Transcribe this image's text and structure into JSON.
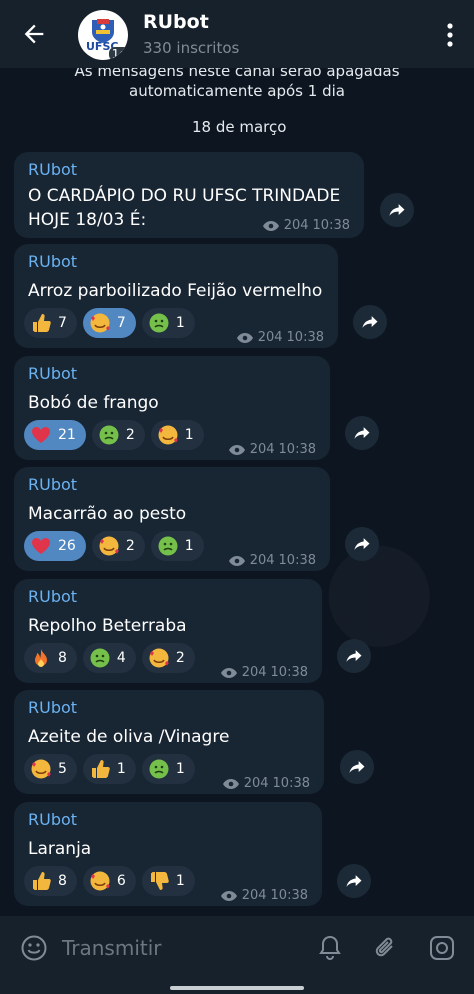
{
  "header": {
    "title": "RUbot",
    "subtitle": "330 inscritos",
    "avatar_text": "UFSC",
    "avatar_timer": "1d"
  },
  "system_message": {
    "line1": "As mensagens neste canal serão apagadas",
    "line2": "automaticamente após 1 dia"
  },
  "date_chip": "18 de março",
  "messages": [
    {
      "author": "RUbot",
      "text": "O CARDÁPIO DO RU UFSC TRINDADE",
      "text2": "HOJE 18/03 É:",
      "views": "204",
      "time": "10:38"
    },
    {
      "author": "RUbot",
      "text": "Arroz parboilizado Feijão vermelho",
      "views": "204",
      "time": "10:38",
      "reactions": [
        {
          "emoji": "thumbs-up",
          "count": "7"
        },
        {
          "emoji": "smiling-face-with-hearts",
          "count": "7",
          "active": true
        },
        {
          "emoji": "nauseated-face",
          "count": "1"
        }
      ]
    },
    {
      "author": "RUbot",
      "text": "Bobó de frango",
      "views": "204",
      "time": "10:38",
      "reactions": [
        {
          "emoji": "red-heart",
          "count": "21",
          "active": true
        },
        {
          "emoji": "nauseated-face",
          "count": "2"
        },
        {
          "emoji": "smiling-face-with-hearts",
          "count": "1"
        }
      ]
    },
    {
      "author": "RUbot",
      "text": "Macarrão ao pesto",
      "views": "204",
      "time": "10:38",
      "reactions": [
        {
          "emoji": "red-heart",
          "count": "26",
          "active": true
        },
        {
          "emoji": "smiling-face-with-hearts",
          "count": "2"
        },
        {
          "emoji": "nauseated-face",
          "count": "1"
        }
      ]
    },
    {
      "author": "RUbot",
      "text": "Repolho Beterraba",
      "views": "204",
      "time": "10:38",
      "reactions": [
        {
          "emoji": "fire",
          "count": "8"
        },
        {
          "emoji": "nauseated-face",
          "count": "4"
        },
        {
          "emoji": "smiling-face-with-hearts",
          "count": "2"
        }
      ]
    },
    {
      "author": "RUbot",
      "text": "Azeite de oliva /Vinagre",
      "views": "204",
      "time": "10:38",
      "reactions": [
        {
          "emoji": "smiling-face-with-hearts",
          "count": "5"
        },
        {
          "emoji": "thumbs-up",
          "count": "1"
        },
        {
          "emoji": "nauseated-face",
          "count": "1"
        }
      ]
    },
    {
      "author": "RUbot",
      "text": "Laranja",
      "views": "204",
      "time": "10:38",
      "reactions": [
        {
          "emoji": "thumbs-up",
          "count": "8"
        },
        {
          "emoji": "smiling-face-with-hearts",
          "count": "6"
        },
        {
          "emoji": "thumbs-down",
          "count": "1"
        }
      ]
    }
  ],
  "input": {
    "placeholder": "Transmitir"
  },
  "colors": {
    "accent": "#6ab2f2",
    "bubble": "#182533",
    "active_reaction": "#5288c1"
  }
}
